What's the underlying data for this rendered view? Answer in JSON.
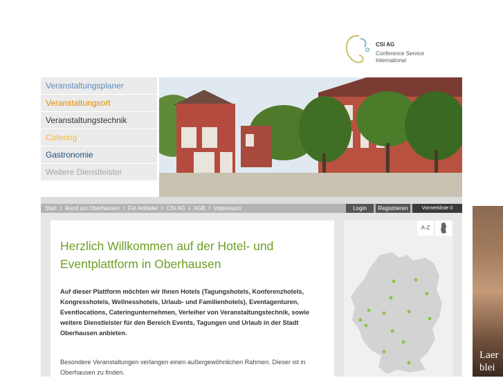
{
  "logo": {
    "title": "CSI AG",
    "subtitle_line1": "Conference Service",
    "subtitle_line2": "International",
    "icon": "csi-swirl-logo"
  },
  "sidebar": {
    "items": [
      {
        "label": "Veranstaltungsplaner",
        "color": "#5a8dbf"
      },
      {
        "label": "Veranstaltungsort",
        "color": "#e48a00"
      },
      {
        "label": "Veranstaltungstechnik",
        "color": "#333333"
      },
      {
        "label": "Catering",
        "color": "#f5b640"
      },
      {
        "label": "Gastronomie",
        "color": "#1e4f7a"
      },
      {
        "label": "Weitere Dienstleister",
        "color": "#a5a5a5"
      }
    ]
  },
  "topnav": {
    "links": [
      "Start",
      "Rund um Oberhausen",
      "Für Anbieter",
      "CSI AG",
      "AGB",
      "Impressum"
    ],
    "separator": "I",
    "login": "Login",
    "register": "Registrieren",
    "merkliste": "Vormerkliste 0"
  },
  "main": {
    "headline": "Herzlich Willkommen auf der Hotel- und Eventplattform in Oberhausen",
    "intro": "Auf dieser Plattform möchten wir Ihnen Hotels (Tagungshotels, Konferenzhotels, Kongresshotels, Wellnesshotels, Urlaub- und Familienhotels), Eventagenturen, Eventlocations, Cateringunternehmen, Verleiher von Veranstaltungstechnik, sowie weitere Dienstleister für den Bereich Events, Tagungen und Urlaub in der Stadt Oberhausen anbieten.",
    "paragraph": "Besondere Veranstaltungen verlangen einen außergewöhnlichen Rahmen. Dieser ist in Oberhausen zu finden."
  },
  "mappanel": {
    "az_label": "A-Z",
    "map_icon": "germany-map-icon"
  },
  "ad": {
    "text_line1": "Laer",
    "text_line2": "blei"
  },
  "colors": {
    "accent_green": "#6e9e24",
    "nav_bar": "#b3b3b3",
    "panel_bg": "#e6e6e6"
  }
}
